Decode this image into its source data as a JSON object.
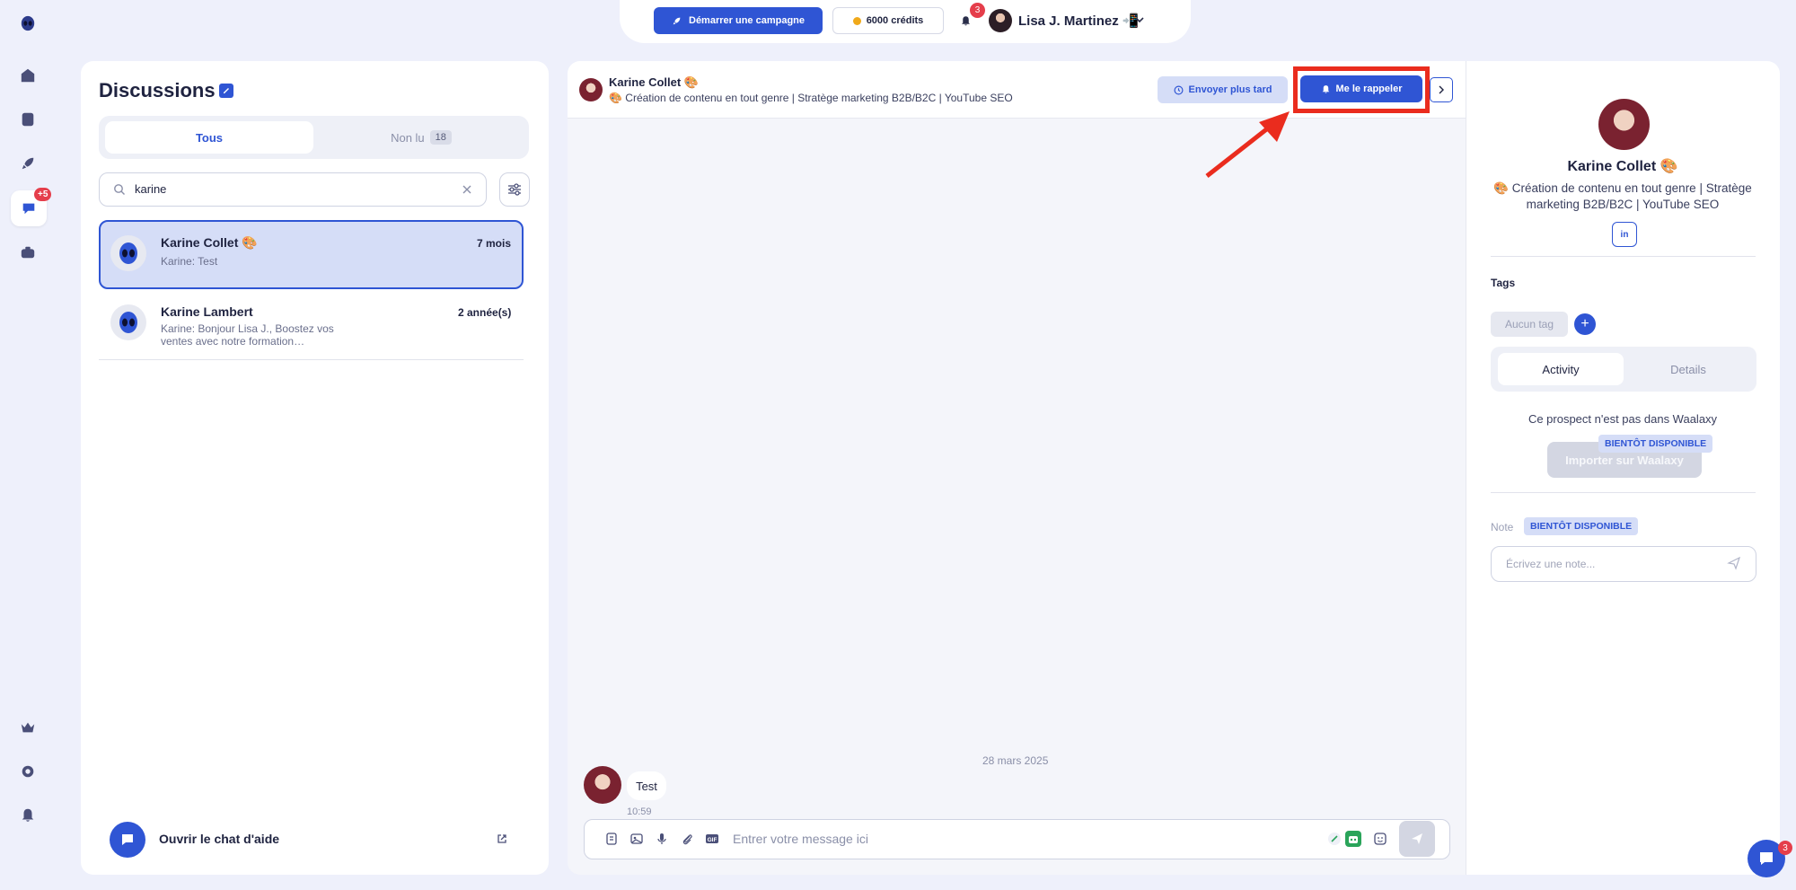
{
  "topbar": {
    "campaign_button": "Démarrer une campagne",
    "credits": "6000 crédits",
    "notifications_count": "3",
    "user_name": "Lisa J. Martinez 📲"
  },
  "rail": {
    "messages_badge": "+5"
  },
  "discussions": {
    "title": "Discussions",
    "tabs": {
      "all": "Tous",
      "unread": "Non lu",
      "unread_count": "18"
    },
    "search_value": "karine",
    "conversations": [
      {
        "name": "Karine Collet 🎨",
        "time": "7 mois",
        "preview": "Karine: Test"
      },
      {
        "name": "Karine Lambert",
        "time": "2 année(s)",
        "preview": "Karine: Bonjour Lisa J., Boostez vos ventes avec notre formation…"
      }
    ],
    "help_label": "Ouvrir le chat d'aide"
  },
  "chat": {
    "contact_name": "Karine Collet 🎨",
    "contact_headline": "🎨 Création de contenu en tout genre | Stratège marketing B2B/B2C | YouTube SEO",
    "send_later": "Envoyer plus tard",
    "remind_me": "Me le rappeler",
    "date_separator": "28 mars 2025",
    "messages": [
      {
        "text": "Test",
        "time": "10:59"
      }
    ],
    "composer_placeholder": "Entrer votre message ici"
  },
  "profile": {
    "name": "Karine Collet 🎨",
    "bio": "🎨 Création de contenu en tout genre | Stratège marketing B2B/B2C | YouTube SEO",
    "linkedin": "in",
    "tags_label": "Tags",
    "no_tag": "Aucun tag",
    "tabs": {
      "activity": "Activity",
      "details": "Details"
    },
    "not_in_waalaxy": "Ce prospect n'est pas dans Waalaxy",
    "import_button": "Importer sur Waalaxy",
    "coming_soon": "BIENTÔT DISPONIBLE",
    "note_label": "Note",
    "note_placeholder": "Écrivez une note..."
  },
  "intercom": {
    "badge": "3"
  },
  "colors": {
    "accent": "#2f55d4",
    "highlight": "#ea2c1e",
    "badge": "#e53e4b"
  }
}
